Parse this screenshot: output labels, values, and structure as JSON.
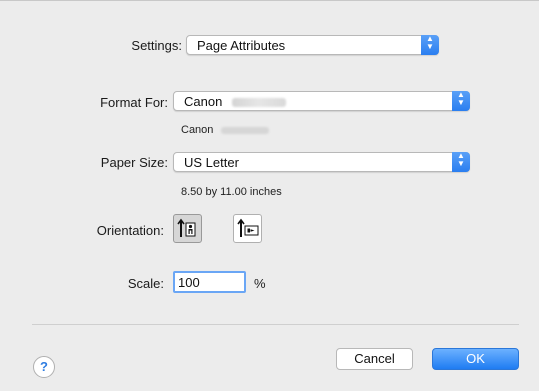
{
  "settings": {
    "label": "Settings:",
    "value": "Page Attributes"
  },
  "format_for": {
    "label": "Format For:",
    "value": "Canon",
    "subtext": "Canon"
  },
  "paper_size": {
    "label": "Paper Size:",
    "value": "US Letter",
    "dimensions": "8.50 by 11.00 inches"
  },
  "orientation": {
    "label": "Orientation:",
    "options": [
      {
        "icon": "portrait-orientation-icon",
        "selected": true
      },
      {
        "icon": "landscape-orientation-icon",
        "selected": false
      }
    ]
  },
  "scale": {
    "label": "Scale:",
    "value": "100",
    "unit": "%"
  },
  "help": {
    "symbol": "?"
  },
  "buttons": {
    "cancel": "Cancel",
    "ok": "OK"
  },
  "colors": {
    "accent": "#2a7ef0",
    "background": "#ececec"
  }
}
